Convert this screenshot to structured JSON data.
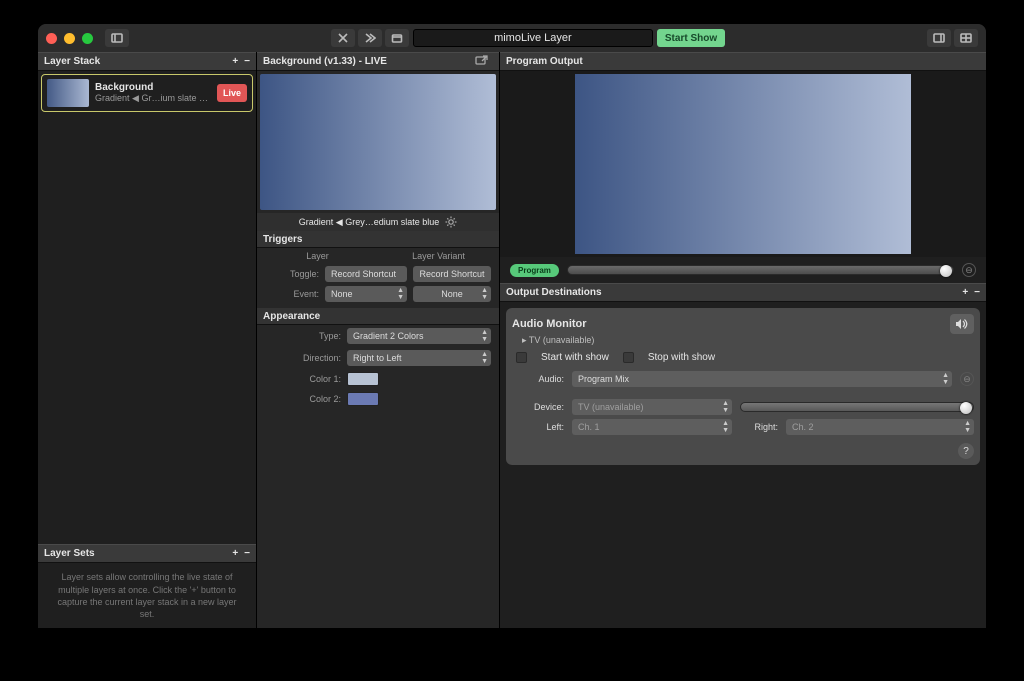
{
  "window": {
    "title": "mimoLive Layer",
    "start_show": "Start Show"
  },
  "titlebar_icons": {
    "sidebar_toggle": "sidebar-toggle-icon",
    "cut": "cut-icon",
    "fwd": "forward-icon",
    "clapper": "clapper-icon",
    "panel_left": "panel-left-icon",
    "panel_grid": "panel-grid-icon"
  },
  "layer_stack": {
    "header": "Layer Stack",
    "item": {
      "title": "Background",
      "subtitle": "Gradient ◀ Gr…ium slate blue",
      "badge": "Live"
    }
  },
  "layer_sets": {
    "header": "Layer Sets",
    "help": "Layer sets allow controlling the live state of multiple layers at once. Click the '+' button to capture the current layer stack in a new layer set."
  },
  "mid": {
    "header": "Background (v1.33) - LIVE",
    "preview_caption": "Gradient ◀ Grey…edium slate blue",
    "triggers": {
      "header": "Triggers",
      "col_layer": "Layer",
      "col_variant": "Layer Variant",
      "toggle_label": "Toggle:",
      "toggle_layer": "Record Shortcut",
      "toggle_variant": "Record Shortcut",
      "event_label": "Event:",
      "event_layer": "None",
      "event_variant": "None"
    },
    "appearance": {
      "header": "Appearance",
      "type_label": "Type:",
      "type_value": "Gradient 2 Colors",
      "direction_label": "Direction:",
      "direction_value": "Right to Left",
      "color1_label": "Color 1:",
      "color2_label": "Color 2:"
    }
  },
  "right": {
    "program_output_header": "Program Output",
    "program_badge": "Program",
    "output_dest_header": "Output Destinations",
    "audio_monitor": {
      "title": "Audio Monitor",
      "device_line": "TV (unavailable)",
      "start_with_show": "Start with show",
      "stop_with_show": "Stop with show",
      "audio_label": "Audio:",
      "audio_value": "Program Mix",
      "device_label": "Device:",
      "device_value": "TV (unavailable)",
      "left_label": "Left:",
      "left_value": "Ch. 1",
      "right_label": "Right:",
      "right_value": "Ch. 2"
    }
  },
  "colors": {
    "accent": "#5b7aa3",
    "live": "#e15656",
    "program": "#57c97a",
    "swatch1": "#b7c2d3",
    "swatch2": "#6b7ab3"
  }
}
